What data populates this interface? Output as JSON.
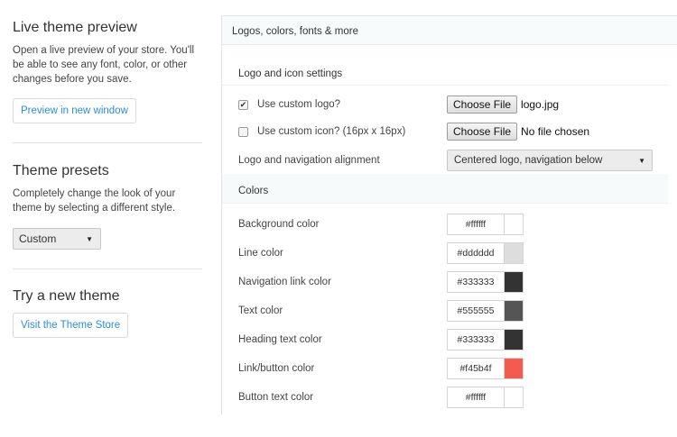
{
  "sidebar": {
    "live_preview": {
      "title": "Live theme preview",
      "description": "Open a live preview of your store. You'll be able to see any font, color, or other changes before you save.",
      "button": "Preview in new window"
    },
    "presets": {
      "title": "Theme presets",
      "description": "Completely change the look of your theme by selecting a different style.",
      "selected": "Custom"
    },
    "new_theme": {
      "title": "Try a new theme",
      "button": "Visit the Theme Store"
    }
  },
  "panel": {
    "header": "Logos, colors, fonts & more",
    "logo_section": {
      "title": "Logo and icon settings",
      "custom_logo": {
        "label": "Use custom logo?",
        "checked": true,
        "button": "Choose File",
        "file": "logo.jpg"
      },
      "custom_icon": {
        "label": "Use custom icon? (16px x 16px)",
        "checked": false,
        "button": "Choose File",
        "file": "No file chosen"
      },
      "alignment": {
        "label": "Logo and navigation alignment",
        "selected": "Centered logo, navigation below"
      }
    },
    "colors_section": {
      "title": "Colors",
      "items": [
        {
          "label": "Background color",
          "value": "#ffffff",
          "swatch": "#ffffff"
        },
        {
          "label": "Line color",
          "value": "#dddddd",
          "swatch": "#dddddd"
        },
        {
          "label": "Navigation link color",
          "value": "#333333",
          "swatch": "#333333"
        },
        {
          "label": "Text color",
          "value": "#555555",
          "swatch": "#555555"
        },
        {
          "label": "Heading text color",
          "value": "#333333",
          "swatch": "#333333"
        },
        {
          "label": "Link/button color",
          "value": "#f45b4f",
          "swatch": "#f45b4f"
        },
        {
          "label": "Button text color",
          "value": "#ffffff",
          "swatch": "#ffffff"
        }
      ]
    }
  }
}
